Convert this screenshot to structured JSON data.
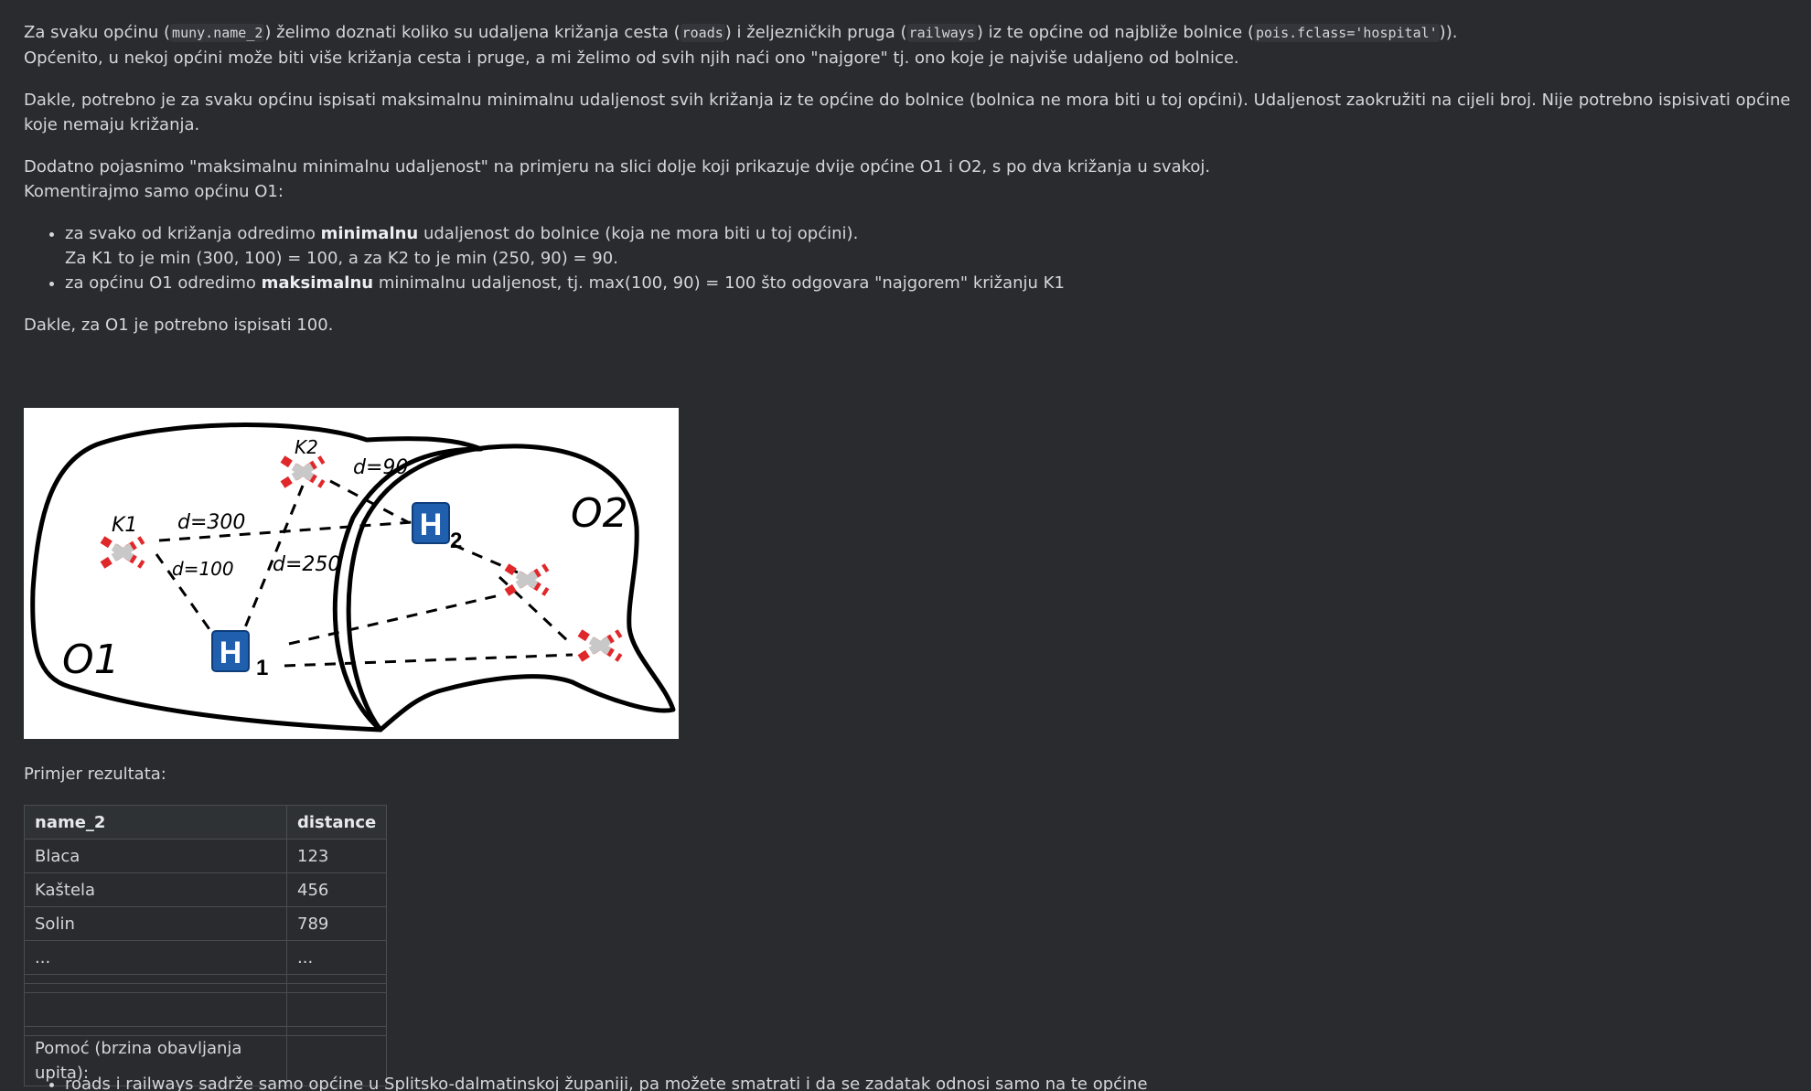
{
  "intro": {
    "p1_a": "Za svaku općinu (",
    "p1_code1": "muny.name_2",
    "p1_b": ") želimo doznati koliko su udaljena križanja cesta (",
    "p1_code2": "roads",
    "p1_c": ") i željezničkih pruga (",
    "p1_code3": "railways",
    "p1_d": ") iz te općine od najbliže bolnice (",
    "p1_code4": "pois.fclass='hospital'",
    "p1_e": ")).",
    "p1_line2": "Općenito, u nekoj općini može biti više križanja cesta i pruge, a mi želimo od svih njih naći ono \"najgore\" tj. ono koje je najviše udaljeno od bolnice.",
    "p2": "Dakle, potrebno je za svaku općinu ispisati maksimalnu minimalnu udaljenost svih križanja iz te općine do bolnice (bolnica ne mora biti u toj općini). Udaljenost zaokružiti na cijeli broj. Nije potrebno ispisivati općine koje nemaju križanja.",
    "p3_line1": "Dodatno pojasnimo \"maksimalnu minimalnu udaljenost\" na primjeru na slici dolje koji prikazuje dvije općine O1 i O2, s po dva križanja u svakoj.",
    "p3_line2": "Komentirajmo samo općinu O1:"
  },
  "bullets": {
    "b1_a": "za svako od križanja odredimo ",
    "b1_bold": "minimalnu",
    "b1_b": " udaljenost do bolnice (koja ne mora biti u toj općini).",
    "b1_line2": "Za K1 to je min (300, 100) = 100, a za K2 to je min (250, 90) = 90.",
    "b2_a": "za općinu O1 odredimo ",
    "b2_bold": "maksimalnu",
    "b2_b": " minimalnu udaljenost, tj. max(100, 90) = 100 što odgovara \"najgorem\" križanju K1"
  },
  "conclusion": "Dakle, za O1 je potrebno ispisati 100.",
  "figure": {
    "label_k1": "K1",
    "label_k2": "K2",
    "label_d300": "d=300",
    "label_d100": "d=100",
    "label_d250": "d=250",
    "label_d90": "d=90",
    "label_o1": "O1",
    "label_o2": "O2",
    "label_h1": "H",
    "label_h1_sub": "1",
    "label_h2": "H",
    "label_h2_sub": "2"
  },
  "result_label": "Primjer rezultata:",
  "table": {
    "headers": [
      "name_2",
      "distance"
    ],
    "rows": [
      [
        "Blaca",
        "123"
      ],
      [
        "Kaštela",
        "456"
      ],
      [
        "Solin",
        "789"
      ],
      [
        "...",
        "..."
      ]
    ],
    "help_row": "Pomoć (brzina obavljanja upita):"
  },
  "tail_bullet": "roads i railways sadrže samo općine u Splitsko-dalmatinskoj županiji, pa možete smatrati i da se zadatak odnosi samo na te općine",
  "colors": {
    "background": "#2a2b2f",
    "text": "#d5d6d8",
    "hospital_blue": "#1f5fae",
    "crossing_red": "#e0282b"
  }
}
